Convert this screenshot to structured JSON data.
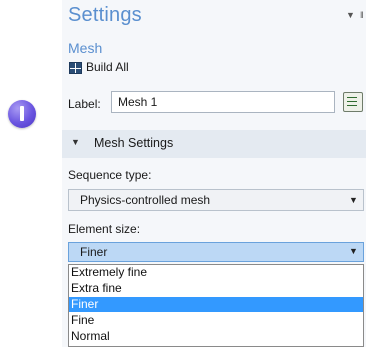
{
  "panel": {
    "title": "Settings",
    "subtitle": "Mesh",
    "toolbar": {
      "build_all_label": "Build All"
    }
  },
  "label_field": {
    "label": "Label:",
    "value": "Mesh 1"
  },
  "section": {
    "title": "Mesh Settings",
    "expanded": true
  },
  "sequence_type": {
    "label": "Sequence type:",
    "value": "Physics-controlled mesh"
  },
  "element_size": {
    "label": "Element size:",
    "value": "Finer",
    "options": [
      "Extremely fine",
      "Extra fine",
      "Finer",
      "Fine",
      "Normal"
    ],
    "selected_index": 2
  },
  "colors": {
    "title_blue": "#5a8fcf",
    "section_bg": "#e4eaf1",
    "selected_option": "#3399ff",
    "open_select_bg": "#bcd8f5",
    "badge": "#6a55e0"
  },
  "icons": {
    "badge": "info-badge-icon",
    "build": "build-all-icon",
    "label_button": "rename-icon",
    "collapse": "triangle-down-icon",
    "dropdown": "chevron-down-icon",
    "pin": "pin-icon"
  }
}
